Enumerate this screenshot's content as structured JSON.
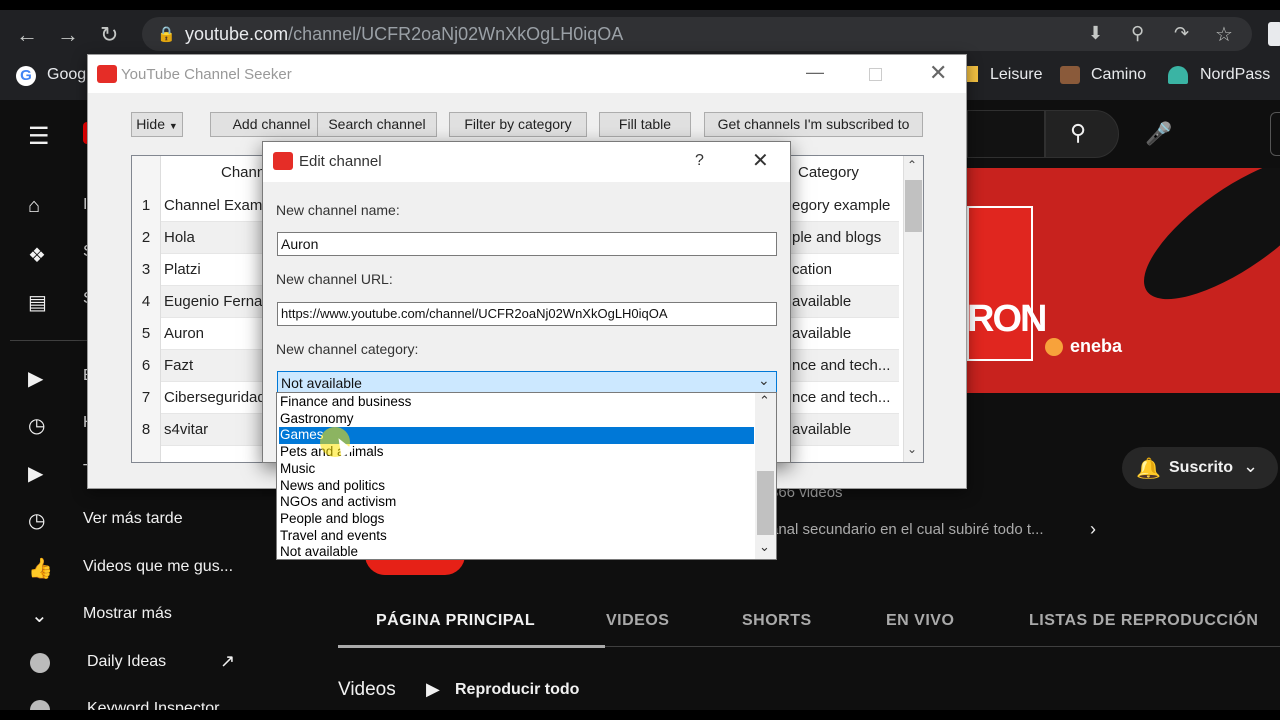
{
  "browser": {
    "url_host": "youtube.com",
    "url_path": "/channel/UCFR2oaNj02WnXkOgLH0iqOA",
    "bookmarks": [
      "Goog",
      "Leisure",
      "Camino",
      "NordPass"
    ]
  },
  "youtube": {
    "sidebar": {
      "items": [
        "Ver más tarde",
        "Videos que me gus...",
        "Mostrar más",
        "Daily Ideas",
        "Keyword Inspector"
      ],
      "partial_letters": [
        "I",
        "S",
        "S",
        "E",
        "H",
        "T"
      ]
    },
    "subscribe_label": "Suscrito",
    "channel_stats": "366 videos",
    "channel_desc": "anal secundario en el cual subiré todo t...",
    "banner_text": "RON",
    "banner_sponsor": "eneba",
    "tabs": [
      "PÁGINA PRINCIPAL",
      "VIDEOS",
      "SHORTS",
      "EN VIVO",
      "LISTAS DE REPRODUCCIÓN"
    ],
    "section_title": "Videos",
    "play_all_label": "Reproducir todo"
  },
  "seeker": {
    "title": "YouTube Channel Seeker",
    "toolbar": [
      "Hide",
      "Add channel",
      "Search channel",
      "Filter by category",
      "Fill table",
      "Get channels I'm subscribed to"
    ],
    "table": {
      "headers": [
        "Chann",
        "Category"
      ],
      "rows": [
        {
          "num": "1",
          "name": "Channel Examp",
          "category": "egory example"
        },
        {
          "num": "2",
          "name": "Hola",
          "category": "ple and blogs"
        },
        {
          "num": "3",
          "name": "Platzi",
          "category": "cation"
        },
        {
          "num": "4",
          "name": "Eugenio Ferna",
          "category": "available"
        },
        {
          "num": "5",
          "name": "Auron",
          "category": "available"
        },
        {
          "num": "6",
          "name": "Fazt",
          "category": "nce and tech..."
        },
        {
          "num": "7",
          "name": "Ciberseguridad",
          "category": "nce and tech..."
        },
        {
          "num": "8",
          "name": "s4vitar",
          "category": "available"
        }
      ]
    }
  },
  "dialog": {
    "title": "Edit channel",
    "help": "?",
    "name_label": "New channel name:",
    "name_value": "Auron",
    "url_label": "New channel URL:",
    "url_value": "https://www.youtube.com/channel/UCFR2oaNj02WnXkOgLH0iqOA",
    "category_label": "New channel category:",
    "category_value": "Not available",
    "options": [
      "Finance and business",
      "Gastronomy",
      "Games",
      "Pets and animals",
      "Music",
      "News and politics",
      "NGOs and activism",
      "People and blogs",
      "Travel and events",
      "Not available"
    ],
    "highlighted_option": "Games"
  }
}
